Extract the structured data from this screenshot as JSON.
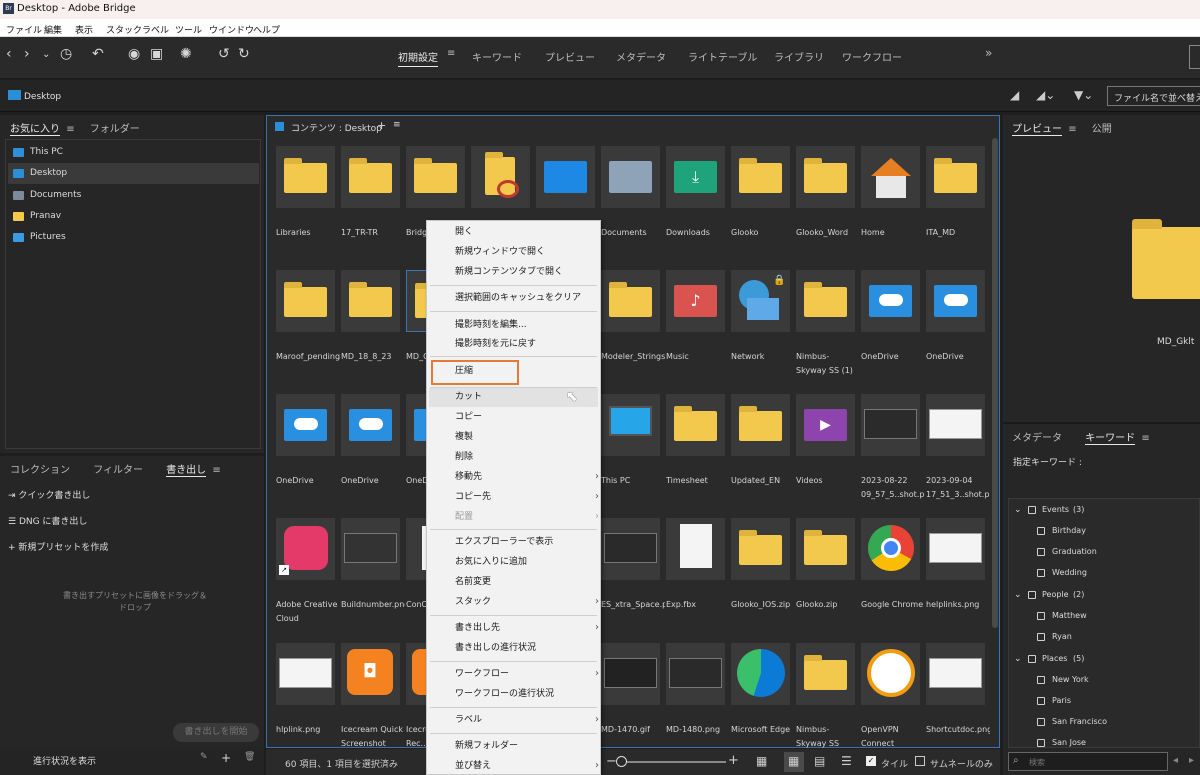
{
  "title": "Desktop - Adobe Bridge",
  "menubar": [
    "ファイル",
    "編集",
    "表示",
    "スタック",
    "ラベル",
    "ツール",
    "ウインドウ",
    "ヘルプ"
  ],
  "workspaces": {
    "active": "初期設定",
    "items": [
      "キーワード",
      "プレビュー",
      "メタデータ",
      "ライトテーブル",
      "ライブラリ",
      "ワークフロー"
    ],
    "more": "»"
  },
  "path": {
    "current": "Desktop"
  },
  "sort_label": "ファイル名で並べ替え",
  "left_tabs": {
    "favorites": "お気に入り",
    "folders": "フォルダー"
  },
  "favorites": [
    {
      "label": "This PC",
      "color": "#2f8fd8"
    },
    {
      "label": "Desktop",
      "color": "#2a8fd6"
    },
    {
      "label": "Documents",
      "color": "#7c8a99"
    },
    {
      "label": "Pranav",
      "color": "#f2c94c"
    },
    {
      "label": "Pictures",
      "color": "#3a9be0"
    }
  ],
  "bottom_tabs": {
    "collections": "コレクション",
    "filter": "フィルター",
    "export": "書き出し"
  },
  "export_items": [
    "クイック書き出し",
    "DNG に書き出し",
    "新規プリセットを作成"
  ],
  "export_hint": "書き出すプリセットに画像をドラッグ＆ドロップ",
  "export_start": "書き出しを開始",
  "progress": "進行状況を表示",
  "content_header": "コンテンツ : Desktop",
  "items": [
    [
      "Libraries",
      "17_TR-TR",
      "Bridge...",
      "",
      "",
      "Documents",
      "Downloads",
      "Glooko",
      "Glooko_Word",
      "Home",
      "ITA_MD"
    ],
    [
      "Maroof_pending",
      "MD_18_8_23",
      "MD_C...",
      "",
      "",
      "Modeler_Strings13thJu..thJuly",
      "Music",
      "Network",
      "Nimbus- Skyway SS (1)",
      "OneDrive",
      "OneDrive"
    ],
    [
      "OneDrive",
      "OneDrive",
      "OneD...",
      "",
      "",
      "This PC",
      "Timesheet",
      "Updated_EN",
      "Videos",
      "2023-08-22 09_57_5..shot.png",
      "2023-09-04 17_51_3..shot.png"
    ],
    [
      "Adobe Creative Cloud",
      "Buildnumber.png",
      "ConC...",
      "",
      "",
      "ES_xtra_Space.png",
      "Exp.fbx",
      "Glooko_IOS.zip",
      "Glooko.zip",
      "Google Chrome",
      "helplinks.png"
    ],
    [
      "hlplink.png",
      "Icecream Quick Screenshot",
      "Icecream Rec...",
      "",
      "",
      "MD-1470.gif",
      "MD-1480.png",
      "Microsoft Edge",
      "Nimbus- Skyway SS (1).zip",
      "OpenVPN Connect",
      "Shortcutdoc.png"
    ]
  ],
  "context_menu": [
    {
      "label": "開く"
    },
    {
      "label": "新規ウィンドウで開く"
    },
    {
      "label": "新規コンテンツタブで開く"
    },
    {
      "label": "選択範囲のキャッシュをクリア"
    },
    {
      "label": "撮影時刻を編集..."
    },
    {
      "label": "撮影時刻を元に戻す"
    },
    {
      "label": "圧縮"
    },
    {
      "label": "カット"
    },
    {
      "label": "コピー"
    },
    {
      "label": "複製"
    },
    {
      "label": "削除"
    },
    {
      "label": "移動先"
    },
    {
      "label": "コピー先"
    },
    {
      "label": "配置"
    },
    {
      "label": "エクスプローラーで表示"
    },
    {
      "label": "お気に入りに追加"
    },
    {
      "label": "名前変更"
    },
    {
      "label": "スタック"
    },
    {
      "label": "書き出し先"
    },
    {
      "label": "書き出しの進行状況"
    },
    {
      "label": "ワークフロー"
    },
    {
      "label": "ワークフローの進行状況"
    },
    {
      "label": "ラベル"
    },
    {
      "label": "新規フォルダー"
    },
    {
      "label": "並び替え"
    }
  ],
  "right_tabs": {
    "preview": "プレビュー",
    "publish": "公開",
    "metadata": "メタデータ",
    "keywords": "キーワード"
  },
  "preview_name": "MD_Gklt",
  "assigned_keywords": "指定キーワード :",
  "keywords": [
    {
      "group": "Events",
      "count": "(3)",
      "items": [
        "Birthday",
        "Graduation",
        "Wedding"
      ]
    },
    {
      "group": "People",
      "count": "(2)",
      "items": [
        "Matthew",
        "Ryan"
      ]
    },
    {
      "group": "Places",
      "count": "(5)",
      "items": [
        "New York",
        "Paris",
        "San Francisco",
        "San Jose"
      ]
    }
  ],
  "search_placeholder": "検索",
  "status": {
    "count": "60 項目、1 項目を選択済み",
    "tile": "タイル",
    "thumb_only": "サムネールのみ"
  }
}
